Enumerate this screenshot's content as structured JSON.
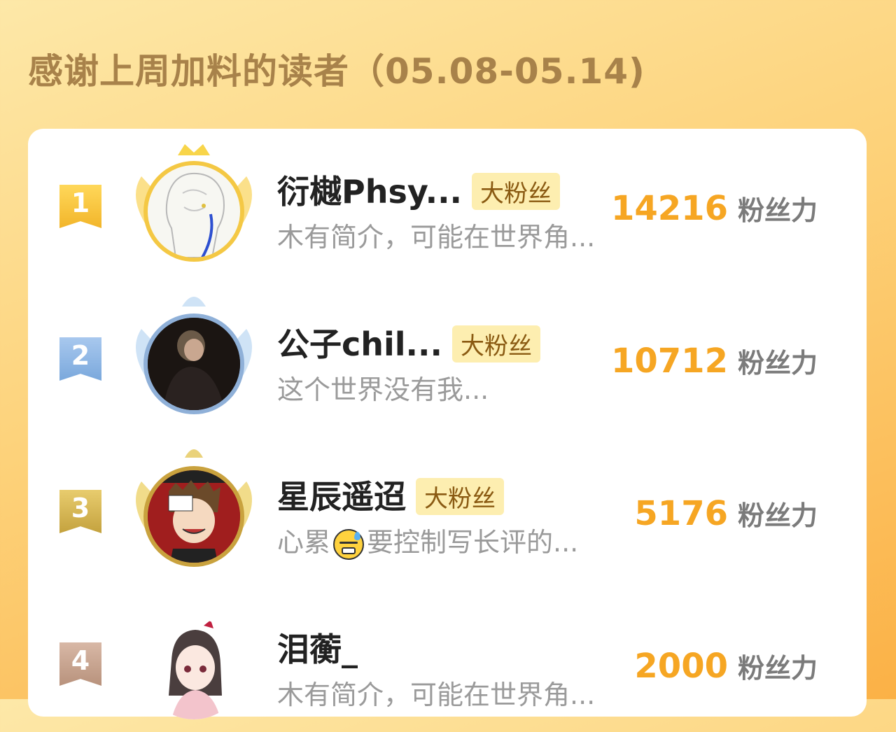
{
  "header": {
    "title": "感谢上周加料的读者（05.08-05.14)"
  },
  "colors": {
    "accent": "#f6a623",
    "badge_bg": "#fdeeb0",
    "gold": "#f2b52a",
    "silver": "#7aa8dc",
    "bronze": "#c4a23e"
  },
  "readers": [
    {
      "rank": "1",
      "name": "衍樾Phsy...",
      "badge": "大粉丝",
      "bio": "木有简介，可能在世界角...",
      "score": "14216",
      "unit": "粉丝力",
      "avatar_icon": "avatar-sketch-figure"
    },
    {
      "rank": "2",
      "name": "公子chil...",
      "badge": "大粉丝",
      "bio": "这个世界没有我...",
      "score": "10712",
      "unit": "粉丝力",
      "avatar_icon": "avatar-dark-figure"
    },
    {
      "rank": "3",
      "name": "星辰遥迢",
      "badge": "大粉丝",
      "bio_before": "心累",
      "bio_after": "要控制写长评的...",
      "bio_emoji": "anxious-sweat-emoji",
      "score": "5176",
      "unit": "粉丝力",
      "avatar_icon": "avatar-manga-character"
    },
    {
      "rank": "4",
      "name": "泪蘅_",
      "bio": "木有简介，可能在世界角...",
      "score": "2000",
      "unit": "粉丝力",
      "avatar_icon": "avatar-anime-girl"
    }
  ]
}
